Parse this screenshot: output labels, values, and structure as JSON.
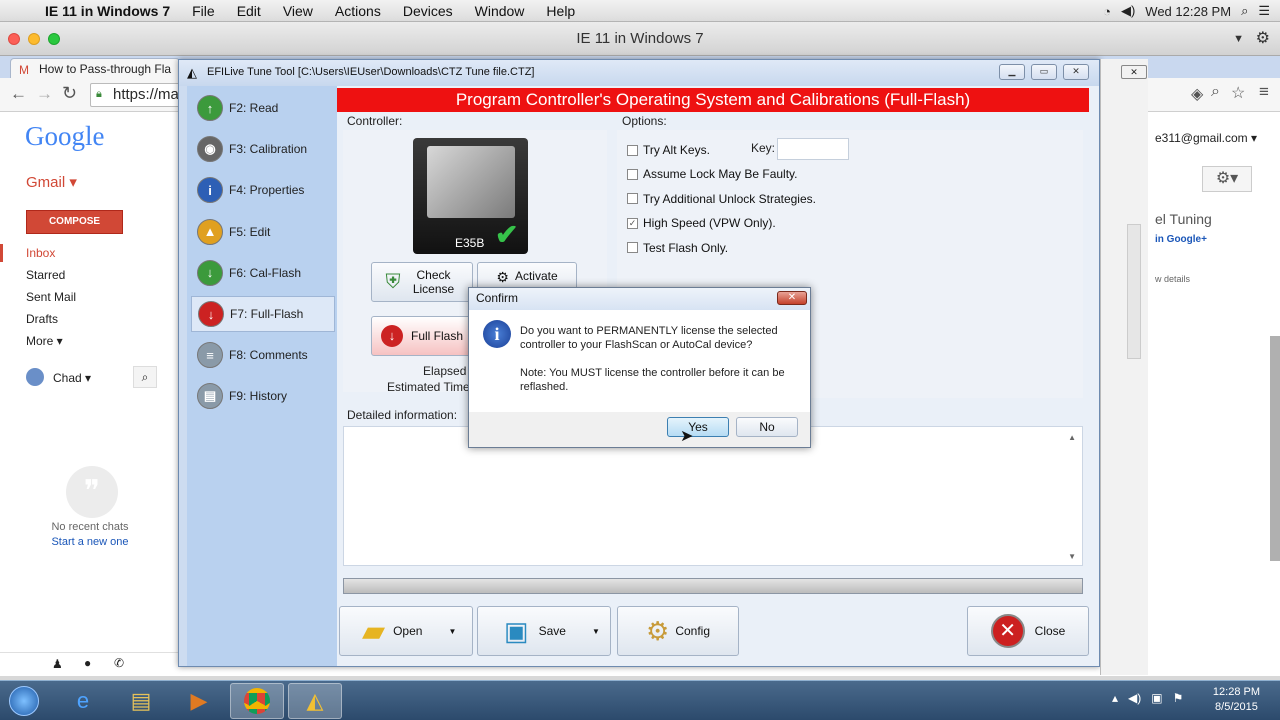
{
  "mac_menu": {
    "app": "IE 11 in Windows 7",
    "items": [
      "File",
      "Edit",
      "View",
      "Actions",
      "Devices",
      "Window",
      "Help"
    ],
    "clock": "Wed 12:28 PM"
  },
  "vm_title": "IE 11 in Windows 7",
  "browser": {
    "tab_title": "How to Pass-through Fla",
    "url": "https://ma"
  },
  "gmail": {
    "logo": "Google",
    "app_label": "Gmail ▾",
    "compose": "COMPOSE",
    "nav": [
      "Inbox",
      "Starred",
      "Sent Mail",
      "Drafts",
      "More ▾"
    ],
    "user": "Chad ▾",
    "no_chats": "No recent chats",
    "start_chat": "Start a new one",
    "account": "e311@gmail.com ▾",
    "right_title": "el Tuning",
    "right_sub": "in Google+",
    "right_details": "w details"
  },
  "efi": {
    "title": "EFILive Tune Tool [C:\\Users\\IEUser\\Downloads\\CTZ Tune file.CTZ]",
    "menu": [
      {
        "key": "F2: Read",
        "icon": "read-icon",
        "color": "#3c9a3c",
        "glyph": "↑"
      },
      {
        "key": "F3: Calibration",
        "icon": "calibration-icon",
        "color": "#666666",
        "glyph": "◉"
      },
      {
        "key": "F4: Properties",
        "icon": "properties-icon",
        "color": "#2d5fb5",
        "glyph": "i"
      },
      {
        "key": "F5: Edit",
        "icon": "edit-icon",
        "color": "#e0a020",
        "glyph": "▲"
      },
      {
        "key": "F6: Cal-Flash",
        "icon": "cal-flash-icon",
        "color": "#3c9a3c",
        "glyph": "↓"
      },
      {
        "key": "F7: Full-Flash",
        "icon": "full-flash-icon",
        "color": "#cc2222",
        "glyph": "↓"
      },
      {
        "key": "F8: Comments",
        "icon": "comments-icon",
        "color": "#8a9aa8",
        "glyph": "≡"
      },
      {
        "key": "F9: History",
        "icon": "history-icon",
        "color": "#8a9aa8",
        "glyph": "▤"
      }
    ],
    "header": "Program Controller's Operating System and Calibrations (Full-Flash)",
    "controller_label": "Controller:",
    "controller_name": "E35B",
    "check_license": "Check License",
    "activate": "Activate",
    "full_flash": "Full Flash",
    "elapsed": "Elapsed T",
    "estimated": "Estimated Time",
    "options_label": "Options:",
    "options": [
      {
        "label": "Try Alt Keys.",
        "checked": ""
      },
      {
        "label": "Assume Lock May Be Faulty.",
        "checked": ""
      },
      {
        "label": "Try Additional Unlock Strategies.",
        "checked": ""
      },
      {
        "label": "High Speed (VPW Only).",
        "checked": "✓"
      },
      {
        "label": "Test Flash Only.",
        "checked": ""
      }
    ],
    "key_label": "Key:",
    "detailed_label": "Detailed information:",
    "toolbar": {
      "open": "Open",
      "save": "Save",
      "config": "Config",
      "close": "Close"
    }
  },
  "dialog": {
    "title": "Confirm",
    "close": "✕",
    "message": "Do you want to PERMANENTLY license the selected controller to your FlashScan or AutoCal device?",
    "note": "Note: You MUST license the controller before it can be reflashed.",
    "yes": "Yes",
    "no": "No"
  },
  "taskbar": {
    "time": "12:28 PM",
    "date": "8/5/2015"
  }
}
